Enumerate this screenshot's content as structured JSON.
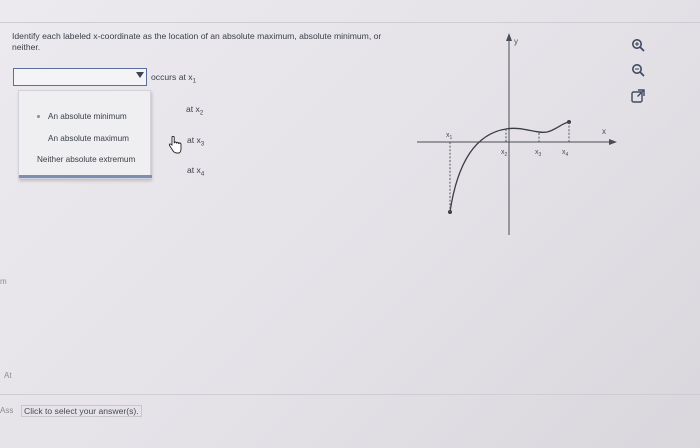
{
  "question": {
    "text": "Identify each labeled x-coordinate as the location of an absolute maximum, absolute minimum, or neither."
  },
  "rows": [
    {
      "selected": "",
      "suffix": "occurs at x",
      "sub": "1"
    },
    {
      "suffix": "at x",
      "sub": "2"
    },
    {
      "suffix": "at x",
      "sub": "3"
    },
    {
      "suffix": "at x",
      "sub": "4"
    }
  ],
  "dropdown_options": [
    "An absolute minimum",
    "An absolute maximum",
    "Neither absolute extremum"
  ],
  "graph": {
    "y_axis_label": "y",
    "x_axis_label": "x",
    "point_labels": [
      "x",
      "x",
      "x",
      "x"
    ],
    "point_subs": [
      "1",
      "2",
      "3",
      "4"
    ]
  },
  "icons": [
    "magnify-plus-icon",
    "magnify-minus-icon",
    "external-link-icon"
  ],
  "edge_texts": [
    "m",
    "At",
    "Ass"
  ],
  "footer": {
    "message": "Click to select your answer(s)."
  },
  "colors": {
    "accent": "#5a6f9e",
    "background": "#e6e4e8"
  }
}
